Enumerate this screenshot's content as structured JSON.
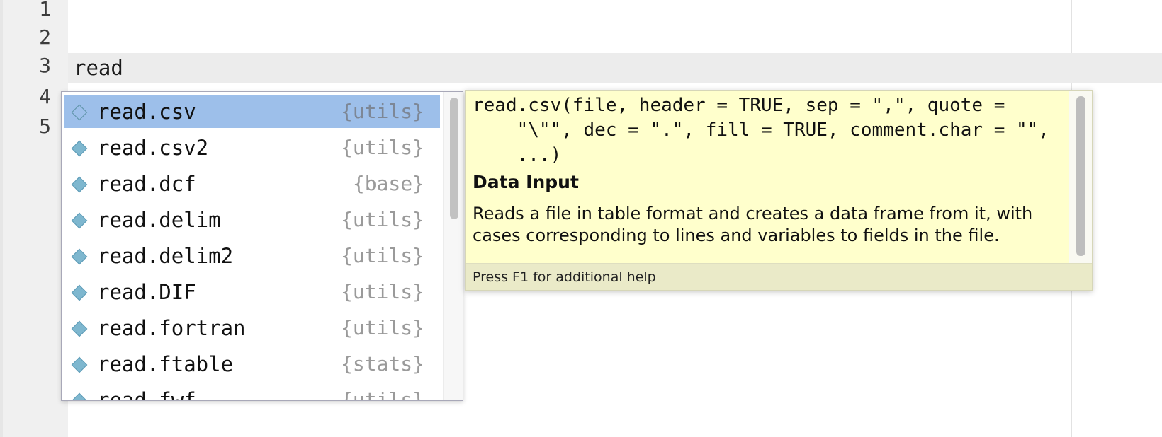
{
  "editor": {
    "line_numbers": [
      "1",
      "2",
      "3",
      "4",
      "5"
    ],
    "current_line_text": "read"
  },
  "completion": {
    "items": [
      {
        "name": "read.csv",
        "package": "{utils}",
        "icon": "function-icon"
      },
      {
        "name": "read.csv2",
        "package": "{utils}",
        "icon": "function-icon"
      },
      {
        "name": "read.dcf",
        "package": "{base}",
        "icon": "function-icon"
      },
      {
        "name": "read.delim",
        "package": "{utils}",
        "icon": "function-icon"
      },
      {
        "name": "read.delim2",
        "package": "{utils}",
        "icon": "function-icon"
      },
      {
        "name": "read.DIF",
        "package": "{utils}",
        "icon": "function-icon"
      },
      {
        "name": "read.fortran",
        "package": "{utils}",
        "icon": "function-icon"
      },
      {
        "name": "read.ftable",
        "package": "{stats}",
        "icon": "function-icon"
      },
      {
        "name": "read.fwf",
        "package": "{utils}",
        "icon": "function-icon"
      }
    ],
    "selected_index": 0
  },
  "help": {
    "signature": "read.csv(file, header = TRUE, sep = \",\", quote =\n    \"\\\"\", dec = \".\", fill = TRUE, comment.char = \"\",\n    ...)",
    "title": "Data Input",
    "description": "Reads a file in table format and creates a data frame from it, with cases corresponding to lines and variables to fields in the file.",
    "footer": "Press F1 for additional help"
  },
  "colors": {
    "selection": "#9dbfea",
    "help_background": "#ffffcc",
    "icon": "#7eb7cf"
  }
}
